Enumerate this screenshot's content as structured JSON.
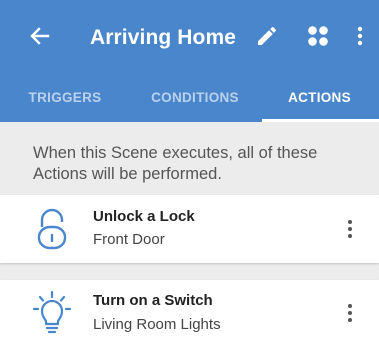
{
  "header": {
    "title": "Arriving Home",
    "icons": {
      "back": "arrow-left-icon",
      "edit": "pencil-icon",
      "apps": "apps-grid-icon",
      "more": "more-vertical-icon"
    }
  },
  "tabs": [
    {
      "label": "TRIGGERS",
      "active": false
    },
    {
      "label": "CONDITIONS",
      "active": false
    },
    {
      "label": "ACTIONS",
      "active": true
    }
  ],
  "intro_text": "When this Scene executes, all of these Actions will be performed.",
  "actions": [
    {
      "title": "Unlock a Lock",
      "subtitle": "Front Door",
      "icon": "unlock-icon"
    },
    {
      "title": "Turn on a Switch",
      "subtitle": "Living Room Lights",
      "icon": "lightbulb-on-icon"
    }
  ],
  "colors": {
    "primary": "#4a86cc",
    "accent_icon": "#4a86cc",
    "background": "#ececec"
  }
}
